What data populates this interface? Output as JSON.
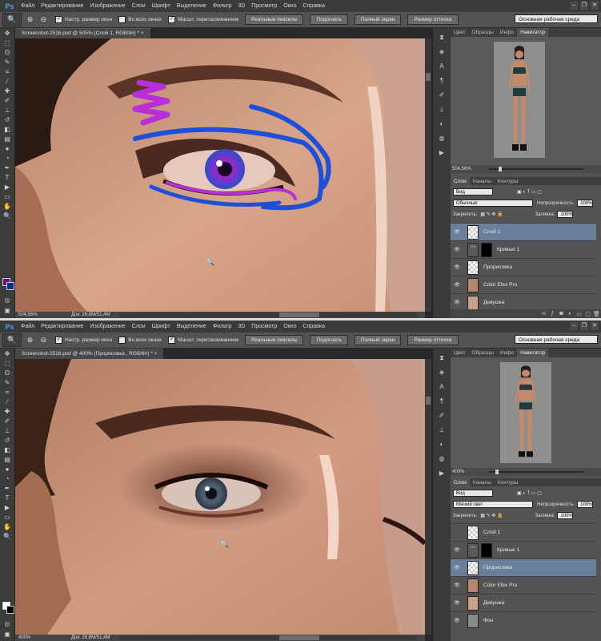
{
  "app": {
    "logo": "Ps",
    "window_controls": [
      "–",
      "❐",
      "✕"
    ]
  },
  "menu": [
    "Файл",
    "Редактирование",
    "Изображение",
    "Слои",
    "Шрифт",
    "Выделение",
    "Фильтр",
    "3D",
    "Просмотр",
    "Окно",
    "Справка"
  ],
  "options": {
    "resize_windows": "Настр. размер окон",
    "all_windows": "Во всех окнах",
    "scrubby_zoom": "Масшт. перетаскиванием",
    "actual_pixels": "Реальные пикселы",
    "fit_screen": "Подогнать",
    "fill_screen": "Полный экран",
    "print_size": "Размер оттиска",
    "workspace": "Основная рабочая среда"
  },
  "panel_tabs": [
    "Цвет",
    "Образцы",
    "Инфо",
    "Навигатор"
  ],
  "layers_tabs": [
    "Слои",
    "Каналы",
    "Контуры"
  ],
  "layers_filter": "Вид",
  "opacity_label": "Непрозрачность:",
  "lock_label": "Закрепить:",
  "fill_label": "Заливка:",
  "layer_names": {
    "layer1": "Слой 1",
    "curves": "Кривые 1",
    "trace": "Прорисовка",
    "cep": "Color Efex Pro",
    "girl": "Девушка",
    "bg": "Фон"
  },
  "windows": [
    {
      "doc_tab": "Screenshot-2516.psd @ 505% (Слой 1, RGB/8#) * ×",
      "zoom": "504,56%",
      "doc_size": "Док: 26,8M/51,4M",
      "nav_zoom": "504,56%",
      "blend_mode": "Обычные",
      "opacity": "100%",
      "fill": "100%"
    },
    {
      "doc_tab": "Screenshot-2516.psd @ 400% (Прорисовка , RGB/8#) * ×",
      "zoom": "400%",
      "doc_size": "Док: 26,8M/51,4M",
      "nav_zoom": "400%",
      "blend_mode": "Мягкий свет",
      "opacity": "100%",
      "fill": "100%"
    }
  ],
  "colors": {
    "foreground_1": "#6a0f8a",
    "background_1": "#0b2f8f",
    "foreground_2": "#ffffff",
    "background_2": "#000000",
    "active_layer": "#6a7f99",
    "brush_purple": "#b82fd9",
    "brush_blue": "#1f4fd6"
  }
}
